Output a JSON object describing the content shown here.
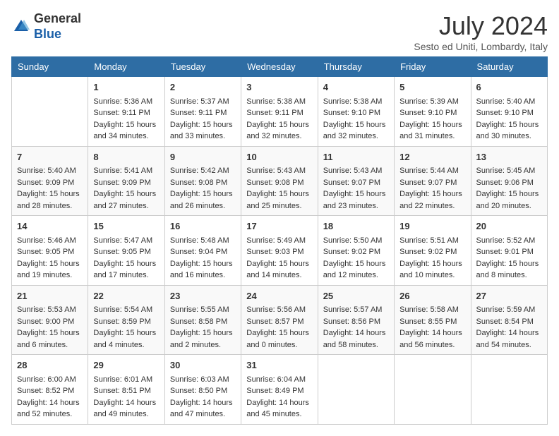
{
  "header": {
    "logo_general": "General",
    "logo_blue": "Blue",
    "month_year": "July 2024",
    "location": "Sesto ed Uniti, Lombardy, Italy"
  },
  "weekdays": [
    "Sunday",
    "Monday",
    "Tuesday",
    "Wednesday",
    "Thursday",
    "Friday",
    "Saturday"
  ],
  "weeks": [
    [
      {
        "day": "",
        "content": ""
      },
      {
        "day": "1",
        "content": "Sunrise: 5:36 AM\nSunset: 9:11 PM\nDaylight: 15 hours\nand 34 minutes."
      },
      {
        "day": "2",
        "content": "Sunrise: 5:37 AM\nSunset: 9:11 PM\nDaylight: 15 hours\nand 33 minutes."
      },
      {
        "day": "3",
        "content": "Sunrise: 5:38 AM\nSunset: 9:11 PM\nDaylight: 15 hours\nand 32 minutes."
      },
      {
        "day": "4",
        "content": "Sunrise: 5:38 AM\nSunset: 9:10 PM\nDaylight: 15 hours\nand 32 minutes."
      },
      {
        "day": "5",
        "content": "Sunrise: 5:39 AM\nSunset: 9:10 PM\nDaylight: 15 hours\nand 31 minutes."
      },
      {
        "day": "6",
        "content": "Sunrise: 5:40 AM\nSunset: 9:10 PM\nDaylight: 15 hours\nand 30 minutes."
      }
    ],
    [
      {
        "day": "7",
        "content": "Sunrise: 5:40 AM\nSunset: 9:09 PM\nDaylight: 15 hours\nand 28 minutes."
      },
      {
        "day": "8",
        "content": "Sunrise: 5:41 AM\nSunset: 9:09 PM\nDaylight: 15 hours\nand 27 minutes."
      },
      {
        "day": "9",
        "content": "Sunrise: 5:42 AM\nSunset: 9:08 PM\nDaylight: 15 hours\nand 26 minutes."
      },
      {
        "day": "10",
        "content": "Sunrise: 5:43 AM\nSunset: 9:08 PM\nDaylight: 15 hours\nand 25 minutes."
      },
      {
        "day": "11",
        "content": "Sunrise: 5:43 AM\nSunset: 9:07 PM\nDaylight: 15 hours\nand 23 minutes."
      },
      {
        "day": "12",
        "content": "Sunrise: 5:44 AM\nSunset: 9:07 PM\nDaylight: 15 hours\nand 22 minutes."
      },
      {
        "day": "13",
        "content": "Sunrise: 5:45 AM\nSunset: 9:06 PM\nDaylight: 15 hours\nand 20 minutes."
      }
    ],
    [
      {
        "day": "14",
        "content": "Sunrise: 5:46 AM\nSunset: 9:05 PM\nDaylight: 15 hours\nand 19 minutes."
      },
      {
        "day": "15",
        "content": "Sunrise: 5:47 AM\nSunset: 9:05 PM\nDaylight: 15 hours\nand 17 minutes."
      },
      {
        "day": "16",
        "content": "Sunrise: 5:48 AM\nSunset: 9:04 PM\nDaylight: 15 hours\nand 16 minutes."
      },
      {
        "day": "17",
        "content": "Sunrise: 5:49 AM\nSunset: 9:03 PM\nDaylight: 15 hours\nand 14 minutes."
      },
      {
        "day": "18",
        "content": "Sunrise: 5:50 AM\nSunset: 9:02 PM\nDaylight: 15 hours\nand 12 minutes."
      },
      {
        "day": "19",
        "content": "Sunrise: 5:51 AM\nSunset: 9:02 PM\nDaylight: 15 hours\nand 10 minutes."
      },
      {
        "day": "20",
        "content": "Sunrise: 5:52 AM\nSunset: 9:01 PM\nDaylight: 15 hours\nand 8 minutes."
      }
    ],
    [
      {
        "day": "21",
        "content": "Sunrise: 5:53 AM\nSunset: 9:00 PM\nDaylight: 15 hours\nand 6 minutes."
      },
      {
        "day": "22",
        "content": "Sunrise: 5:54 AM\nSunset: 8:59 PM\nDaylight: 15 hours\nand 4 minutes."
      },
      {
        "day": "23",
        "content": "Sunrise: 5:55 AM\nSunset: 8:58 PM\nDaylight: 15 hours\nand 2 minutes."
      },
      {
        "day": "24",
        "content": "Sunrise: 5:56 AM\nSunset: 8:57 PM\nDaylight: 15 hours\nand 0 minutes."
      },
      {
        "day": "25",
        "content": "Sunrise: 5:57 AM\nSunset: 8:56 PM\nDaylight: 14 hours\nand 58 minutes."
      },
      {
        "day": "26",
        "content": "Sunrise: 5:58 AM\nSunset: 8:55 PM\nDaylight: 14 hours\nand 56 minutes."
      },
      {
        "day": "27",
        "content": "Sunrise: 5:59 AM\nSunset: 8:54 PM\nDaylight: 14 hours\nand 54 minutes."
      }
    ],
    [
      {
        "day": "28",
        "content": "Sunrise: 6:00 AM\nSunset: 8:52 PM\nDaylight: 14 hours\nand 52 minutes."
      },
      {
        "day": "29",
        "content": "Sunrise: 6:01 AM\nSunset: 8:51 PM\nDaylight: 14 hours\nand 49 minutes."
      },
      {
        "day": "30",
        "content": "Sunrise: 6:03 AM\nSunset: 8:50 PM\nDaylight: 14 hours\nand 47 minutes."
      },
      {
        "day": "31",
        "content": "Sunrise: 6:04 AM\nSunset: 8:49 PM\nDaylight: 14 hours\nand 45 minutes."
      },
      {
        "day": "",
        "content": ""
      },
      {
        "day": "",
        "content": ""
      },
      {
        "day": "",
        "content": ""
      }
    ]
  ]
}
